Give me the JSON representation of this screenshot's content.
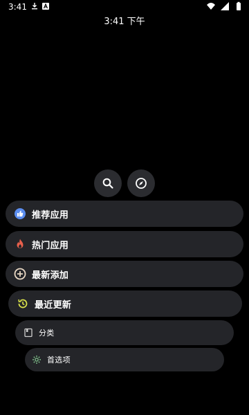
{
  "status_bar": {
    "time": "3:41",
    "icons": [
      "download-icon",
      "a-square-icon",
      "wifi-icon",
      "signal-icon",
      "battery-icon"
    ]
  },
  "clock": {
    "text": "3:41 下午"
  },
  "actions": {
    "search_icon": "search-icon",
    "explore_icon": "compass-icon"
  },
  "menu": {
    "items": [
      {
        "label": "推荐应用",
        "icon": "thumbs-up-icon",
        "color": "#5b8def"
      },
      {
        "label": "热门应用",
        "icon": "fire-icon",
        "color": "#e8604c"
      },
      {
        "label": "最新添加",
        "icon": "add-circle-icon",
        "color": "#e9d8c4"
      },
      {
        "label": "最近更新",
        "icon": "history-icon",
        "color": "#d8e04a"
      },
      {
        "label": "分类",
        "icon": "book-icon",
        "color": "#cfcfcf"
      },
      {
        "label": "首选项",
        "icon": "settings-icon",
        "color": "#7fbf8a"
      }
    ]
  }
}
